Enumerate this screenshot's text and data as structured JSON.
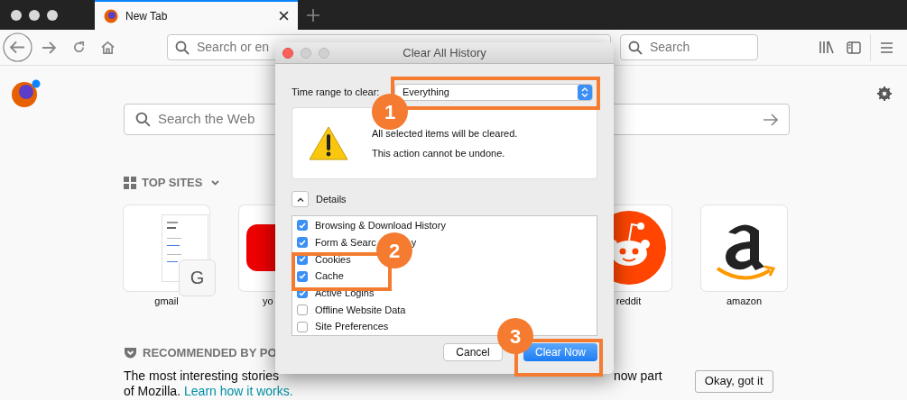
{
  "tab": {
    "title": "New Tab",
    "selected": true
  },
  "url_field": {
    "placeholder": "Search or en"
  },
  "search_field": {
    "placeholder": "Search"
  },
  "page": {
    "search": {
      "placeholder": "Search the Web"
    },
    "top_sites": {
      "heading": "TOP SITES",
      "tiles": [
        {
          "kind": "page",
          "label": "gmail",
          "letter": "G"
        },
        {
          "kind": "red",
          "label": "yo"
        },
        {
          "kind": "reddit",
          "label": "reddit"
        },
        {
          "kind": "amazon",
          "label": "amazon"
        }
      ]
    },
    "recommended": {
      "heading": "RECOMMENDED BY PO",
      "line1": "The most interesting stories",
      "line1_end": "now part",
      "line2": "of Mozilla.",
      "link": "Learn how it works.",
      "button": "Okay, got it"
    }
  },
  "dialog": {
    "title": "Clear All History",
    "time_range": {
      "label": "Time range to clear:",
      "value": "Everything"
    },
    "warning": [
      "All selected items will be cleared.",
      "This action cannot be undone."
    ],
    "details": {
      "label": "Details",
      "expanded": true
    },
    "items": [
      {
        "label": [
          "Browsing & Download History"
        ],
        "checked": true
      },
      {
        "label": [
          "Form & Searc",
          "y"
        ],
        "checked": true
      },
      {
        "label": [
          "Cookies"
        ],
        "checked": true
      },
      {
        "label": [
          "Cache"
        ],
        "checked": true
      },
      {
        "label": [
          "Active Logins"
        ],
        "checked": true
      },
      {
        "label": [
          "Offline Website Data"
        ],
        "checked": false
      },
      {
        "label": [
          "Site Preferences"
        ],
        "checked": false
      }
    ],
    "cancel": "Cancel",
    "confirm": "Clear Now"
  },
  "annotations": [
    {
      "number": "1"
    },
    {
      "number": "2"
    },
    {
      "number": "3"
    }
  ]
}
